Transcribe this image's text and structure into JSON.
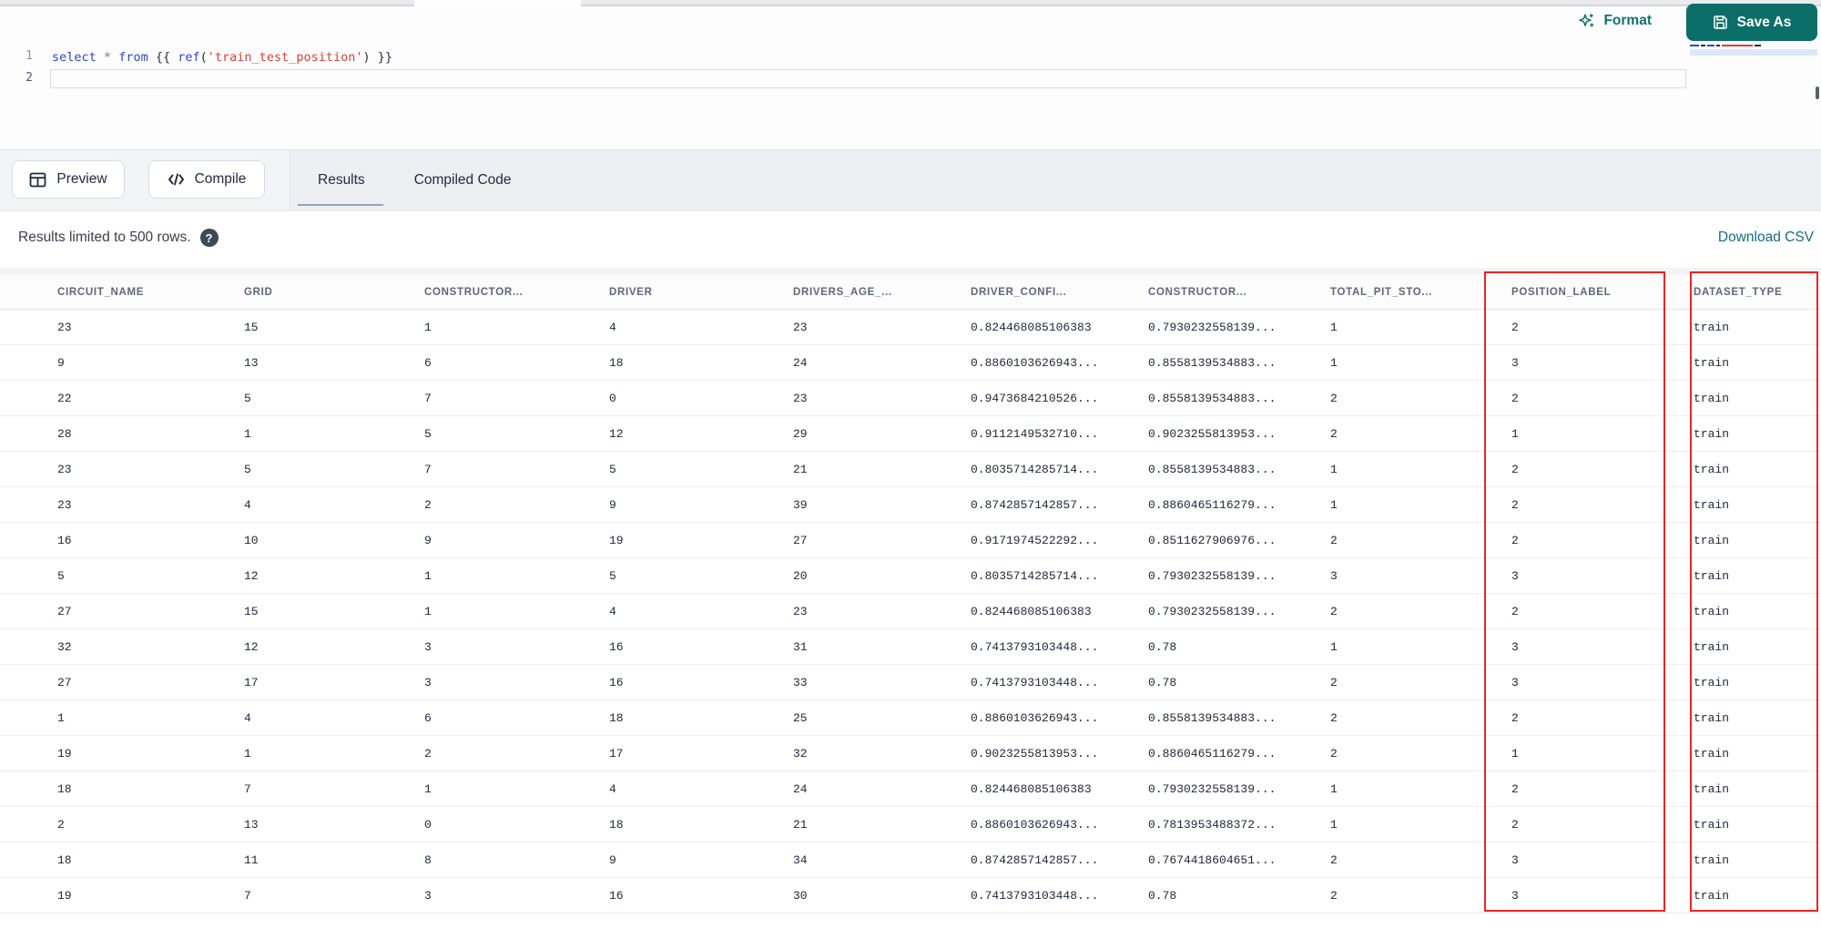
{
  "colors": {
    "accent_teal": "#0c6e69",
    "teal_text": "#0e7270",
    "download_link": "#146e7e",
    "highlight_red": "#ee2424",
    "code_keyword": "#2d47c6",
    "code_string": "#d6433b",
    "code_punct": "#2a2f36",
    "code_operator": "#6f7396",
    "header_text": "#5f6876",
    "cell_text": "#212a38"
  },
  "editor": {
    "line_numbers": [
      "1",
      "2"
    ],
    "code_text": "select * from {{ ref('train_test_position') }}",
    "code_tokens": [
      {
        "text": "select",
        "type": "keyword"
      },
      {
        "text": " ",
        "type": "punct"
      },
      {
        "text": "*",
        "type": "operator"
      },
      {
        "text": " ",
        "type": "punct"
      },
      {
        "text": "from",
        "type": "keyword"
      },
      {
        "text": " ",
        "type": "punct"
      },
      {
        "text": "{{ ",
        "type": "punct"
      },
      {
        "text": "ref",
        "type": "keyword"
      },
      {
        "text": "(",
        "type": "punct"
      },
      {
        "text": "'train_test_position'",
        "type": "string"
      },
      {
        "text": ")",
        "type": "punct"
      },
      {
        "text": " }}",
        "type": "punct"
      }
    ],
    "minimap_segments": [
      {
        "color": "code_keyword",
        "width": 10
      },
      {
        "color": "code_punct",
        "width": 5
      },
      {
        "color": "code_keyword",
        "width": 8
      },
      {
        "color": "code_punct",
        "width": 4
      },
      {
        "color": "code_string",
        "width": 34
      },
      {
        "color": "code_punct",
        "width": 7
      }
    ]
  },
  "topbar": {
    "format_label": "Format",
    "save_as_label": "Save As"
  },
  "toolbar": {
    "preview_label": "Preview",
    "compile_label": "Compile"
  },
  "tabs": {
    "items": [
      {
        "label": "Results"
      },
      {
        "label": "Compiled Code"
      }
    ],
    "active_index": 0
  },
  "results": {
    "limit_note": "Results limited to 500 rows.",
    "help_glyph": "?",
    "download_label": "Download CSV"
  },
  "table": {
    "columns": [
      "CIRCUIT_NAME",
      "GRID",
      "CONSTRUCTOR...",
      "DRIVER",
      "DRIVERS_AGE_...",
      "DRIVER_CONFI...",
      "CONSTRUCTOR...",
      "TOTAL_PIT_STO...",
      "POSITION_LABEL",
      "DATASET_TYPE"
    ],
    "highlighted_columns": [
      "POSITION_LABEL",
      "DATASET_TYPE"
    ],
    "rows": [
      [
        "23",
        "15",
        "1",
        "4",
        "23",
        "0.824468085106383",
        "0.7930232558139...",
        "1",
        "2",
        "train"
      ],
      [
        "9",
        "13",
        "6",
        "18",
        "24",
        "0.8860103626943...",
        "0.8558139534883...",
        "1",
        "3",
        "train"
      ],
      [
        "22",
        "5",
        "7",
        "0",
        "23",
        "0.9473684210526...",
        "0.8558139534883...",
        "2",
        "2",
        "train"
      ],
      [
        "28",
        "1",
        "5",
        "12",
        "29",
        "0.9112149532710...",
        "0.9023255813953...",
        "2",
        "1",
        "train"
      ],
      [
        "23",
        "5",
        "7",
        "5",
        "21",
        "0.8035714285714...",
        "0.8558139534883...",
        "1",
        "2",
        "train"
      ],
      [
        "23",
        "4",
        "2",
        "9",
        "39",
        "0.8742857142857...",
        "0.8860465116279...",
        "1",
        "2",
        "train"
      ],
      [
        "16",
        "10",
        "9",
        "19",
        "27",
        "0.9171974522292...",
        "0.8511627906976...",
        "2",
        "2",
        "train"
      ],
      [
        "5",
        "12",
        "1",
        "5",
        "20",
        "0.8035714285714...",
        "0.7930232558139...",
        "3",
        "3",
        "train"
      ],
      [
        "27",
        "15",
        "1",
        "4",
        "23",
        "0.824468085106383",
        "0.7930232558139...",
        "2",
        "2",
        "train"
      ],
      [
        "32",
        "12",
        "3",
        "16",
        "31",
        "0.7413793103448...",
        "0.78",
        "1",
        "3",
        "train"
      ],
      [
        "27",
        "17",
        "3",
        "16",
        "33",
        "0.7413793103448...",
        "0.78",
        "2",
        "3",
        "train"
      ],
      [
        "1",
        "4",
        "6",
        "18",
        "25",
        "0.8860103626943...",
        "0.8558139534883...",
        "2",
        "2",
        "train"
      ],
      [
        "19",
        "1",
        "2",
        "17",
        "32",
        "0.9023255813953...",
        "0.8860465116279...",
        "2",
        "1",
        "train"
      ],
      [
        "18",
        "7",
        "1",
        "4",
        "24",
        "0.824468085106383",
        "0.7930232558139...",
        "1",
        "2",
        "train"
      ],
      [
        "2",
        "13",
        "0",
        "18",
        "21",
        "0.8860103626943...",
        "0.7813953488372...",
        "1",
        "2",
        "train"
      ],
      [
        "18",
        "11",
        "8",
        "9",
        "34",
        "0.8742857142857...",
        "0.7674418604651...",
        "2",
        "3",
        "train"
      ],
      [
        "19",
        "7",
        "3",
        "16",
        "30",
        "0.7413793103448...",
        "0.78",
        "2",
        "3",
        "train"
      ]
    ]
  }
}
